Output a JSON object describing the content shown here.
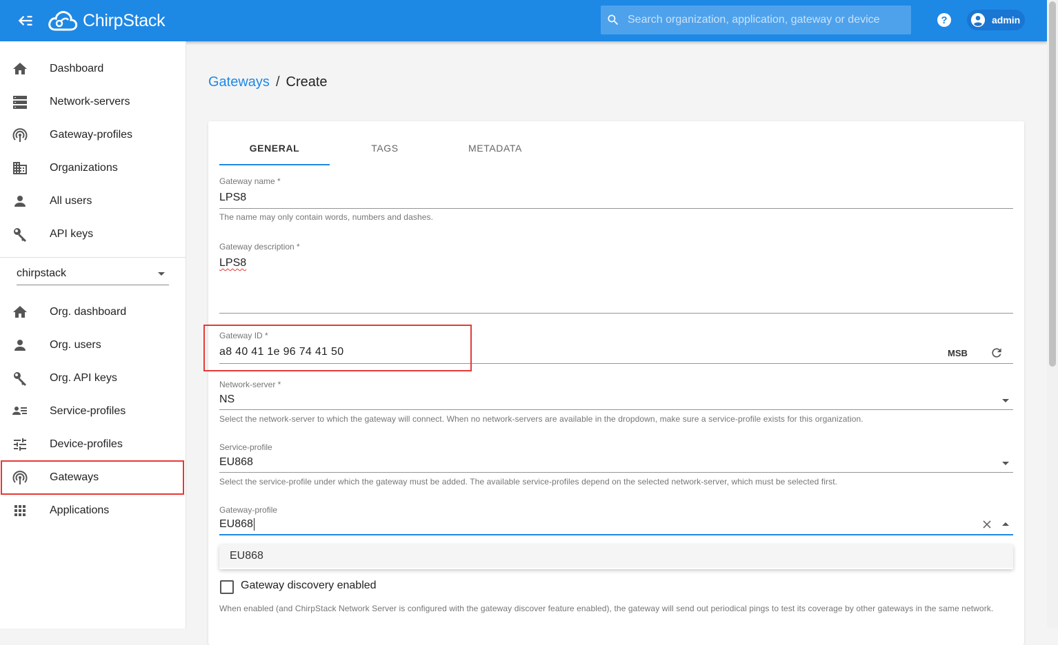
{
  "header": {
    "app_name": "ChirpStack",
    "search_placeholder": "Search organization, application, gateway or device",
    "user_label": "admin"
  },
  "sidebar": {
    "global_items": [
      {
        "label": "Dashboard",
        "icon": "home-icon"
      },
      {
        "label": "Network-servers",
        "icon": "server-icon"
      },
      {
        "label": "Gateway-profiles",
        "icon": "wifi-tethering-icon"
      },
      {
        "label": "Organizations",
        "icon": "domain-icon"
      },
      {
        "label": "All users",
        "icon": "person-icon"
      },
      {
        "label": "API keys",
        "icon": "key-icon"
      }
    ],
    "organization_selected": "chirpstack",
    "org_items": [
      {
        "label": "Org. dashboard",
        "icon": "home-icon"
      },
      {
        "label": "Org. users",
        "icon": "person-icon"
      },
      {
        "label": "Org. API keys",
        "icon": "key-icon"
      },
      {
        "label": "Service-profiles",
        "icon": "account-details-icon"
      },
      {
        "label": "Device-profiles",
        "icon": "tune-icon"
      },
      {
        "label": "Gateways",
        "icon": "wifi-tethering-icon",
        "active": true
      },
      {
        "label": "Applications",
        "icon": "apps-icon"
      }
    ]
  },
  "breadcrumb": {
    "parent": "Gateways",
    "separator": "/",
    "current": "Create"
  },
  "tabs": [
    "GENERAL",
    "TAGS",
    "METADATA"
  ],
  "form": {
    "gateway_name": {
      "label": "Gateway name *",
      "value": "LPS8",
      "help": "The name may only contain words, numbers and dashes."
    },
    "gateway_description": {
      "label": "Gateway description *",
      "value": "LPS8"
    },
    "gateway_id": {
      "label": "Gateway ID *",
      "value": "a8 40 41 1e 96 74 41 50",
      "byte_order": "MSB"
    },
    "network_server": {
      "label": "Network-server *",
      "value": "NS",
      "help": "Select the network-server to which the gateway will connect. When no network-servers are available in the dropdown, make sure a service-profile exists for this organization."
    },
    "service_profile": {
      "label": "Service-profile",
      "value": "EU868",
      "help": "Select the service-profile under which the gateway must be added. The available service-profiles depend on the selected network-server, which must be selected first."
    },
    "gateway_profile": {
      "label": "Gateway-profile",
      "value": "EU868",
      "options": [
        "EU868"
      ]
    },
    "discovery": {
      "label": "Gateway discovery enabled",
      "checked": false,
      "help": "When enabled (and ChirpStack Network Server is configured with the gateway discover feature enabled), the gateway will send out periodical pings to test its coverage by other gateways in the same network."
    }
  },
  "colors": {
    "primary": "#1e88e5",
    "highlight": "#e53935"
  }
}
